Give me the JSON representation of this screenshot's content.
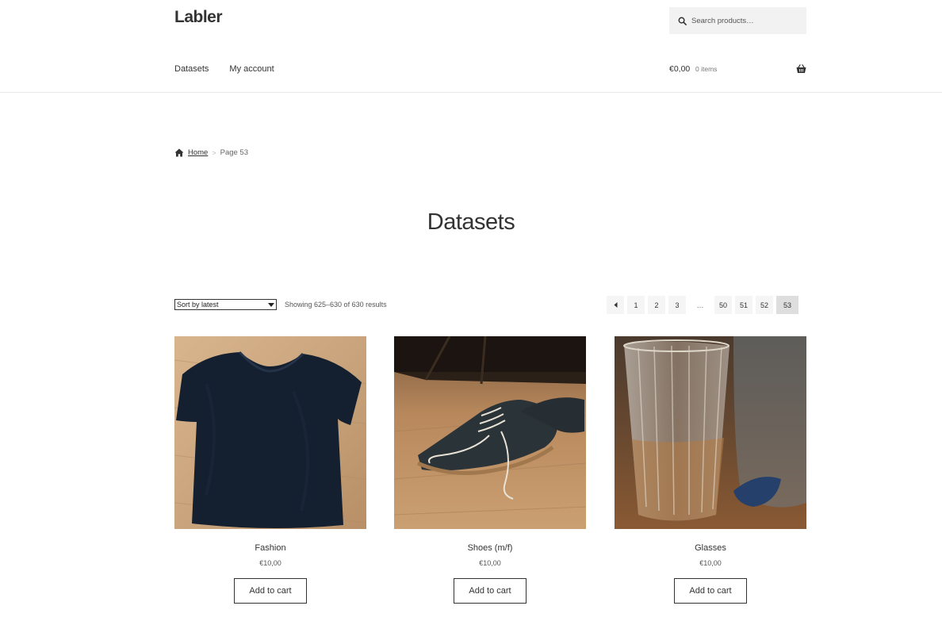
{
  "site": {
    "title": "Labler"
  },
  "search": {
    "placeholder": "Search products…"
  },
  "nav": {
    "items": [
      "Datasets",
      "My account"
    ]
  },
  "cart": {
    "amount": "€0,00",
    "count": "0 items"
  },
  "breadcrumb": {
    "home": "Home",
    "separator": ">",
    "current": "Page 53"
  },
  "page": {
    "title": "Datasets"
  },
  "toolbar": {
    "sort_selected": "Sort by latest",
    "result_count": "Showing 625–630 of 630 results"
  },
  "pagination": {
    "pages": [
      "1",
      "2",
      "3",
      "…",
      "50",
      "51",
      "52",
      "53"
    ],
    "current": "53"
  },
  "products": [
    {
      "name": "Fashion",
      "price": "€10,00",
      "button": "Add to cart",
      "image": "dark-tshirt-photo"
    },
    {
      "name": "Shoes (m/f)",
      "price": "€10,00",
      "button": "Add to cart",
      "image": "suede-shoe-photo"
    },
    {
      "name": "Glasses",
      "price": "€10,00",
      "button": "Add to cart",
      "image": "drinking-glass-photo"
    }
  ],
  "colors": {
    "text": "#333333",
    "muted": "#777777",
    "search_bg": "#f2f2f2",
    "pagination_bg": "#f5f5f5",
    "pagination_current": "#dedede"
  }
}
